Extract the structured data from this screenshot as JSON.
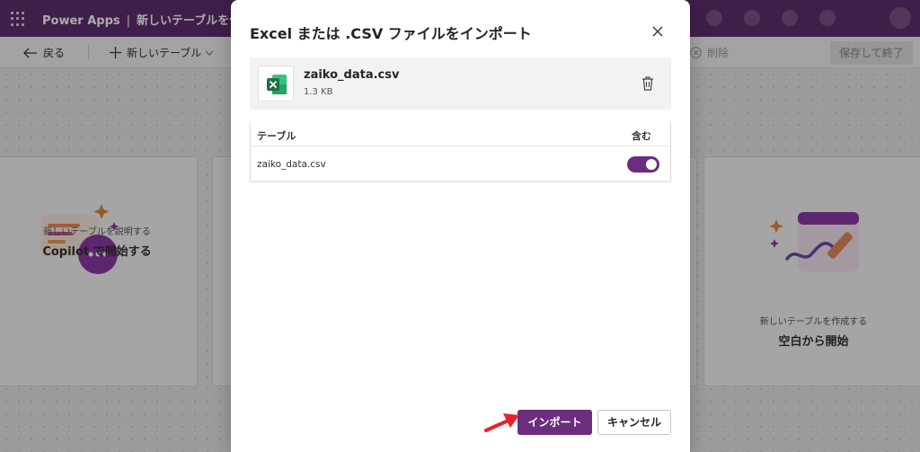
{
  "app": {
    "product": "Power Apps",
    "separator": "|",
    "page_title": "新しいテーブルを作"
  },
  "commandbar": {
    "back_label": "戻る",
    "new_table_label": "新しいテーブル",
    "delete_label": "削除",
    "save_exit_label": "保存して終了"
  },
  "cards": [
    {
      "subtitle": "新しいテーブルを説明する",
      "title": "Copilot で開始する"
    },
    {
      "subtitle": "新しいテーブルを作成する",
      "title": "空白から開始"
    }
  ],
  "dialog": {
    "title": "Excel または .CSV ファイルをインポート",
    "file": {
      "name": "zaiko_data.csv",
      "size": "1.3 KB"
    },
    "table": {
      "col_table": "テーブル",
      "col_include": "含む",
      "rows": [
        {
          "name": "zaiko_data.csv",
          "include": true
        }
      ]
    },
    "import_label": "インポート",
    "cancel_label": "キャンセル"
  },
  "colors": {
    "brand_purple": "#6b2d7e",
    "appbar": "#5e2e6e",
    "annotation_red": "#e8212b",
    "excel_green": "#1e7145"
  }
}
